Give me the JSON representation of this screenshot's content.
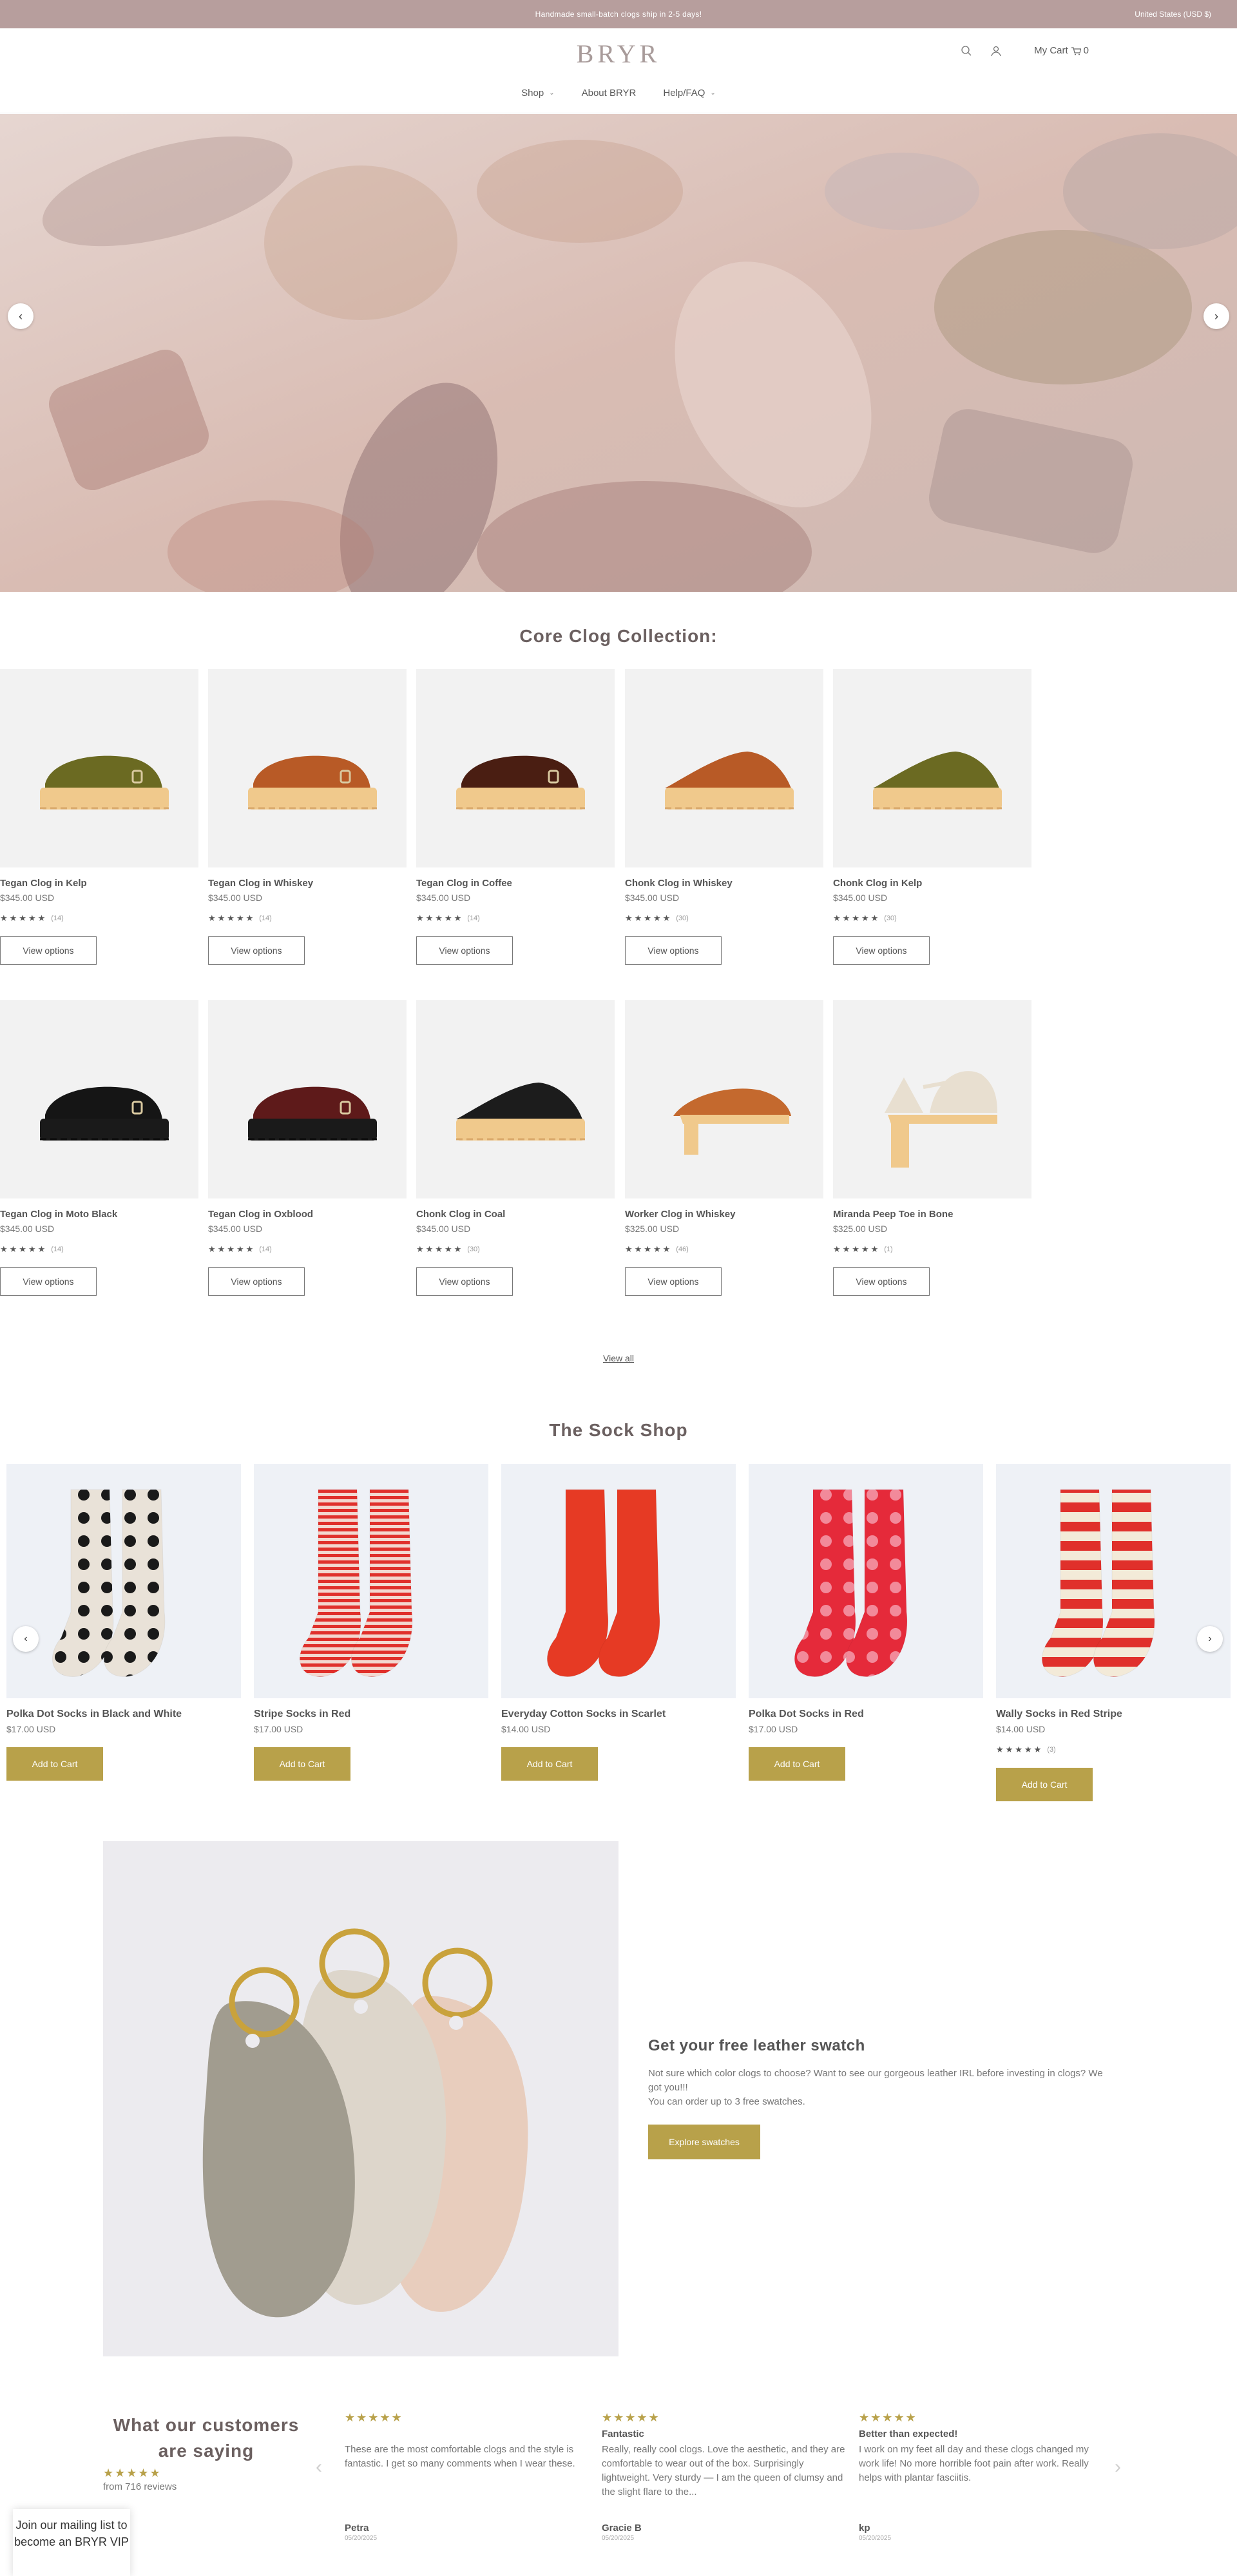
{
  "announcement": {
    "message": "Handmade small-batch clogs ship in 2-5 days!",
    "currency": "United States (USD $)"
  },
  "header": {
    "logo": "BRYR",
    "cart_label": "My Cart",
    "cart_count": "0",
    "nav": [
      {
        "label": "Shop",
        "has_dropdown": true
      },
      {
        "label": "About BRYR",
        "has_dropdown": false
      },
      {
        "label": "Help/FAQ",
        "has_dropdown": true
      }
    ]
  },
  "clogs": {
    "title": "Core Clog Collection:",
    "view_all": "View all",
    "button_label": "View options",
    "products": [
      {
        "name": "Tegan Clog in Kelp",
        "price": "$345.00 USD",
        "stars": "★★★★★",
        "reviews": "(14)",
        "color": "#6b6a22",
        "style": "tegan",
        "sole": "wood"
      },
      {
        "name": "Tegan Clog in Whiskey",
        "price": "$345.00 USD",
        "stars": "★★★★★",
        "reviews": "(14)",
        "color": "#b85a26",
        "style": "tegan",
        "sole": "wood"
      },
      {
        "name": "Tegan Clog in Coffee",
        "price": "$345.00 USD",
        "stars": "★★★★★",
        "reviews": "(14)",
        "color": "#4a1e12",
        "style": "tegan",
        "sole": "wood"
      },
      {
        "name": "Chonk Clog in Whiskey",
        "price": "$345.00 USD",
        "stars": "★★★★★",
        "reviews": "(30)",
        "color": "#b85a26",
        "style": "chonk",
        "sole": "wood"
      },
      {
        "name": "Chonk Clog in Kelp",
        "price": "$345.00 USD",
        "stars": "★★★★★",
        "reviews": "(30)",
        "color": "#6b6a22",
        "style": "chonk",
        "sole": "wood"
      },
      {
        "name": "Tegan Clog in Moto Black",
        "price": "$345.00 USD",
        "stars": "★★★★★",
        "reviews": "(14)",
        "color": "#151515",
        "style": "tegan",
        "sole": "black"
      },
      {
        "name": "Tegan Clog in Oxblood",
        "price": "$345.00 USD",
        "stars": "★★★★★",
        "reviews": "(14)",
        "color": "#5e1a1a",
        "style": "tegan",
        "sole": "black"
      },
      {
        "name": "Chonk Clog in Coal",
        "price": "$345.00 USD",
        "stars": "★★★★★",
        "reviews": "(30)",
        "color": "#1c1c1c",
        "style": "chonk",
        "sole": "wood"
      },
      {
        "name": "Worker Clog in Whiskey",
        "price": "$325.00 USD",
        "stars": "★★★★★",
        "reviews": "(46)",
        "color": "#c4692e",
        "style": "worker",
        "sole": "wood"
      },
      {
        "name": "Miranda Peep Toe in Bone",
        "price": "$325.00 USD",
        "stars": "★★★★★",
        "reviews": "(1)",
        "color": "#e8dfd0",
        "style": "miranda",
        "sole": "wood"
      }
    ]
  },
  "socks": {
    "title": "The Sock Shop",
    "button_label": "Add to Cart",
    "products": [
      {
        "name": "Polka Dot Socks in Black and White",
        "price": "$17.00 USD",
        "stars": "",
        "reviews": "",
        "base": "#e9e2d8",
        "accent": "#1a1a1a",
        "pattern": "dots"
      },
      {
        "name": "Stripe Socks in Red",
        "price": "$17.00 USD",
        "stars": "",
        "reviews": "",
        "base": "#f3d8d0",
        "accent": "#e0302b",
        "pattern": "fine-stripes"
      },
      {
        "name": "Everyday Cotton Socks in Scarlet",
        "price": "$14.00 USD",
        "stars": "",
        "reviews": "",
        "base": "#e63a24",
        "accent": "#e63a24",
        "pattern": "solid"
      },
      {
        "name": "Polka Dot Socks in Red",
        "price": "$17.00 USD",
        "stars": "",
        "reviews": "",
        "base": "#e52a3a",
        "accent": "#f28a9a",
        "pattern": "dots"
      },
      {
        "name": "Wally Socks in Red Stripe",
        "price": "$14.00 USD",
        "stars": "★★★★★",
        "reviews": "(3)",
        "base": "#f3ead8",
        "accent": "#e0302b",
        "pattern": "wide-stripes"
      }
    ]
  },
  "swatch": {
    "title": "Get your free leather swatch",
    "text1": "Not sure which color clogs to choose? Want to see our gorgeous leather IRL before investing in clogs? We got you!!!",
    "text2": "You can order up to 3 free swatches.",
    "button": "Explore swatches"
  },
  "reviews": {
    "title": "What our customers are saying",
    "stars": "★★★★★",
    "count_text": "from 716 reviews",
    "items": [
      {
        "stars": "★★★★★",
        "title": "",
        "body": "These are the most comfortable clogs and the style is fantastic. I get so many comments when I wear these.",
        "author": "Petra",
        "date": "05/20/2025"
      },
      {
        "stars": "★★★★★",
        "title": "Fantastic",
        "body": "Really, really cool clogs. Love the aesthetic, and they are comfortable to wear out of the box. Surprisingly lightweight. Very sturdy — I am the queen of clumsy and the slight flare to the...",
        "author": "Gracie B",
        "date": "05/20/2025"
      },
      {
        "stars": "★★★★★",
        "title": "Better than expected!",
        "body": "I work on my feet all day and these clogs changed my work life! No more horrible foot pain after work. Really helps with plantar fasciitis.",
        "author": "kp",
        "date": "05/20/2025"
      }
    ]
  },
  "mailing": {
    "text": "Join our mailing list to become an BRYR VIP"
  },
  "colors": {
    "announce_bg": "#b79e9d",
    "gold": "#b8a14a",
    "heading": "#6b6060"
  }
}
